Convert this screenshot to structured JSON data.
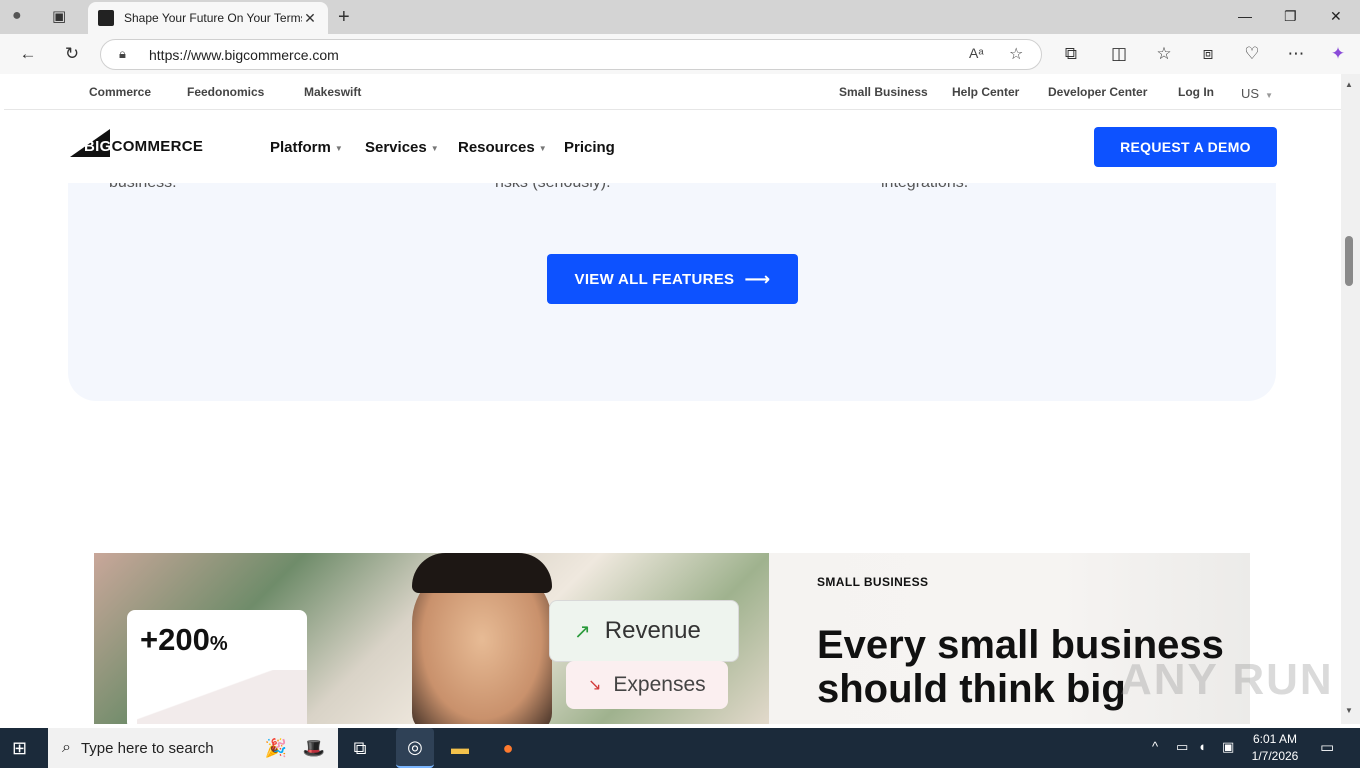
{
  "browser": {
    "tab_title": "Shape Your Future On Your Terms",
    "url": "https://www.bigcommerce.com",
    "new_tab_symbol": "+",
    "close_symbol": "✕"
  },
  "topnav": {
    "left": [
      "Commerce",
      "Feedonomics",
      "Makeswift"
    ],
    "right": [
      "Small Business",
      "Help Center",
      "Developer Center",
      "Log In"
    ],
    "region": "US"
  },
  "mainnav": {
    "logo_big": "BIG",
    "logo_rest": "COMMERCE",
    "items": [
      "Platform",
      "Services",
      "Resources",
      "Pricing"
    ],
    "cta": "REQUEST A DEMO"
  },
  "features": {
    "snippets": [
      "business.",
      "risks (seriously).",
      "integrations."
    ],
    "button": "VIEW ALL FEATURES"
  },
  "hero": {
    "stat_value": "+200",
    "stat_unit": "%",
    "revenue_label": "Revenue",
    "expenses_label": "Expenses",
    "kicker": "SMALL BUSINESS",
    "headline": "Every small business should think big"
  },
  "watermark": "ANY RUN",
  "taskbar": {
    "search_placeholder": "Type here to search",
    "time": "6:01 AM",
    "date": "1/7/2026"
  }
}
